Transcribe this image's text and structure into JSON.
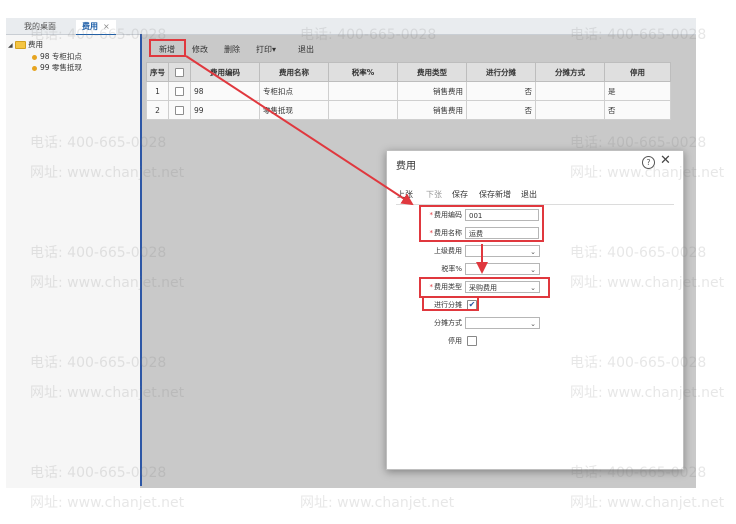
{
  "tabs": [
    {
      "label": "我的桌面"
    },
    {
      "label": "费用",
      "close": "×"
    }
  ],
  "tree": {
    "expander": "◢",
    "root": "费用",
    "children": [
      "98 专柜扣点",
      "99 零售抵现"
    ]
  },
  "toolbar": {
    "new": "新增",
    "edit": "修改",
    "delete": "删除",
    "print": "打印",
    "print_arrow": "▾",
    "exit": "退出"
  },
  "table": {
    "headers": [
      "序号",
      "",
      "费用编码",
      "费用名称",
      "税率%",
      "费用类型",
      "进行分摊",
      "分摊方式",
      "停用"
    ],
    "rows": [
      [
        "1",
        "",
        "98",
        "专柜扣点",
        "",
        "销售费用",
        "否",
        "",
        "是"
      ],
      [
        "2",
        "",
        "99",
        "零售抵现",
        "",
        "销售费用",
        "否",
        "",
        "否"
      ]
    ]
  },
  "modal": {
    "title": "费用",
    "help": "?",
    "close": "✕",
    "toolbar": [
      "上张",
      "下张",
      "保存",
      "保存新增",
      "退出"
    ],
    "req_mark": "*",
    "fields": {
      "code_label": "费用编码",
      "code_value": "001",
      "name_label": "费用名称",
      "name_value": "运费",
      "parent_label": "上级费用",
      "tax_label": "税率%",
      "type_label": "费用类型",
      "type_value": "采购费用",
      "share_label": "进行分摊",
      "share_check": "✔",
      "method_label": "分摊方式",
      "disable_label": "停用"
    },
    "select_arrow": "⌄"
  },
  "watermark": {
    "phone": "电话: 400-665-0028",
    "site": "网址: www.chanjet.net"
  },
  "colors": {
    "accent": "#2d57a6",
    "highlight": "#e0383e"
  }
}
